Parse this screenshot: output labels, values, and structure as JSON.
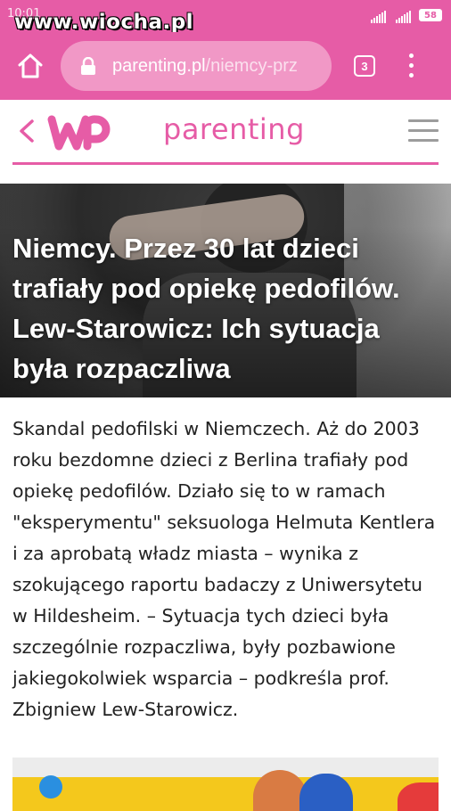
{
  "status_bar": {
    "time": "10:01",
    "watermark": "www.wiocha.pl",
    "battery": "58"
  },
  "browser": {
    "url_host": "parenting.pl",
    "url_path": "/niemcy-prz",
    "tab_count": "3"
  },
  "site": {
    "brand": "parenting"
  },
  "article": {
    "title": "Niemcy. Przez 30 lat dzieci trafiały pod opiekę pedofilów. Lew-Starowicz: Ich sytuacja była rozpaczliwa",
    "lead": "Skandal pedofilski w Niemczech. Aż do 2003 roku bezdomne dzieci z Berlina trafiały pod opiekę pedofilów. Działo się to w ramach \"eksperymentu\" seksuologa Helmuta Kentlera i za aprobatą władz miasta – wynika z szokującego raportu badaczy z Uniwersytetu w Hildesheim. – Sytuacja tych dzieci była szczególnie rozpaczliwa, były pozbawione jakiegokolwiek wsparcia – podkreśla prof. Zbigniew Lew-Starowicz."
  },
  "colors": {
    "brand_pink": "#e65ca6",
    "url_pill": "#f198c6",
    "text": "#222222"
  },
  "icons": [
    "home-icon",
    "lock-icon",
    "tabs-icon",
    "menu-icon",
    "back-icon",
    "wp-logo",
    "hamburger-icon",
    "signal-icon"
  ]
}
